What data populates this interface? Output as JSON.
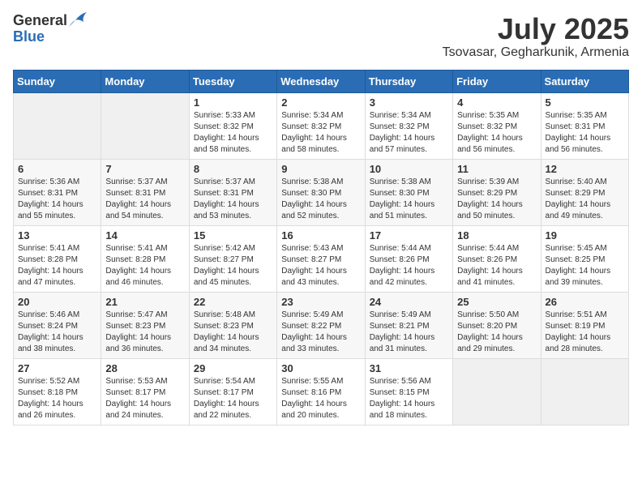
{
  "header": {
    "logo_general": "General",
    "logo_blue": "Blue",
    "month_title": "July 2025",
    "location": "Tsovasar, Gegharkunik, Armenia"
  },
  "weekdays": [
    "Sunday",
    "Monday",
    "Tuesday",
    "Wednesday",
    "Thursday",
    "Friday",
    "Saturday"
  ],
  "weeks": [
    [
      {
        "day": "",
        "text": ""
      },
      {
        "day": "",
        "text": ""
      },
      {
        "day": "1",
        "text": "Sunrise: 5:33 AM\nSunset: 8:32 PM\nDaylight: 14 hours and 58 minutes."
      },
      {
        "day": "2",
        "text": "Sunrise: 5:34 AM\nSunset: 8:32 PM\nDaylight: 14 hours and 58 minutes."
      },
      {
        "day": "3",
        "text": "Sunrise: 5:34 AM\nSunset: 8:32 PM\nDaylight: 14 hours and 57 minutes."
      },
      {
        "day": "4",
        "text": "Sunrise: 5:35 AM\nSunset: 8:32 PM\nDaylight: 14 hours and 56 minutes."
      },
      {
        "day": "5",
        "text": "Sunrise: 5:35 AM\nSunset: 8:31 PM\nDaylight: 14 hours and 56 minutes."
      }
    ],
    [
      {
        "day": "6",
        "text": "Sunrise: 5:36 AM\nSunset: 8:31 PM\nDaylight: 14 hours and 55 minutes."
      },
      {
        "day": "7",
        "text": "Sunrise: 5:37 AM\nSunset: 8:31 PM\nDaylight: 14 hours and 54 minutes."
      },
      {
        "day": "8",
        "text": "Sunrise: 5:37 AM\nSunset: 8:31 PM\nDaylight: 14 hours and 53 minutes."
      },
      {
        "day": "9",
        "text": "Sunrise: 5:38 AM\nSunset: 8:30 PM\nDaylight: 14 hours and 52 minutes."
      },
      {
        "day": "10",
        "text": "Sunrise: 5:38 AM\nSunset: 8:30 PM\nDaylight: 14 hours and 51 minutes."
      },
      {
        "day": "11",
        "text": "Sunrise: 5:39 AM\nSunset: 8:29 PM\nDaylight: 14 hours and 50 minutes."
      },
      {
        "day": "12",
        "text": "Sunrise: 5:40 AM\nSunset: 8:29 PM\nDaylight: 14 hours and 49 minutes."
      }
    ],
    [
      {
        "day": "13",
        "text": "Sunrise: 5:41 AM\nSunset: 8:28 PM\nDaylight: 14 hours and 47 minutes."
      },
      {
        "day": "14",
        "text": "Sunrise: 5:41 AM\nSunset: 8:28 PM\nDaylight: 14 hours and 46 minutes."
      },
      {
        "day": "15",
        "text": "Sunrise: 5:42 AM\nSunset: 8:27 PM\nDaylight: 14 hours and 45 minutes."
      },
      {
        "day": "16",
        "text": "Sunrise: 5:43 AM\nSunset: 8:27 PM\nDaylight: 14 hours and 43 minutes."
      },
      {
        "day": "17",
        "text": "Sunrise: 5:44 AM\nSunset: 8:26 PM\nDaylight: 14 hours and 42 minutes."
      },
      {
        "day": "18",
        "text": "Sunrise: 5:44 AM\nSunset: 8:26 PM\nDaylight: 14 hours and 41 minutes."
      },
      {
        "day": "19",
        "text": "Sunrise: 5:45 AM\nSunset: 8:25 PM\nDaylight: 14 hours and 39 minutes."
      }
    ],
    [
      {
        "day": "20",
        "text": "Sunrise: 5:46 AM\nSunset: 8:24 PM\nDaylight: 14 hours and 38 minutes."
      },
      {
        "day": "21",
        "text": "Sunrise: 5:47 AM\nSunset: 8:23 PM\nDaylight: 14 hours and 36 minutes."
      },
      {
        "day": "22",
        "text": "Sunrise: 5:48 AM\nSunset: 8:23 PM\nDaylight: 14 hours and 34 minutes."
      },
      {
        "day": "23",
        "text": "Sunrise: 5:49 AM\nSunset: 8:22 PM\nDaylight: 14 hours and 33 minutes."
      },
      {
        "day": "24",
        "text": "Sunrise: 5:49 AM\nSunset: 8:21 PM\nDaylight: 14 hours and 31 minutes."
      },
      {
        "day": "25",
        "text": "Sunrise: 5:50 AM\nSunset: 8:20 PM\nDaylight: 14 hours and 29 minutes."
      },
      {
        "day": "26",
        "text": "Sunrise: 5:51 AM\nSunset: 8:19 PM\nDaylight: 14 hours and 28 minutes."
      }
    ],
    [
      {
        "day": "27",
        "text": "Sunrise: 5:52 AM\nSunset: 8:18 PM\nDaylight: 14 hours and 26 minutes."
      },
      {
        "day": "28",
        "text": "Sunrise: 5:53 AM\nSunset: 8:17 PM\nDaylight: 14 hours and 24 minutes."
      },
      {
        "day": "29",
        "text": "Sunrise: 5:54 AM\nSunset: 8:17 PM\nDaylight: 14 hours and 22 minutes."
      },
      {
        "day": "30",
        "text": "Sunrise: 5:55 AM\nSunset: 8:16 PM\nDaylight: 14 hours and 20 minutes."
      },
      {
        "day": "31",
        "text": "Sunrise: 5:56 AM\nSunset: 8:15 PM\nDaylight: 14 hours and 18 minutes."
      },
      {
        "day": "",
        "text": ""
      },
      {
        "day": "",
        "text": ""
      }
    ]
  ]
}
